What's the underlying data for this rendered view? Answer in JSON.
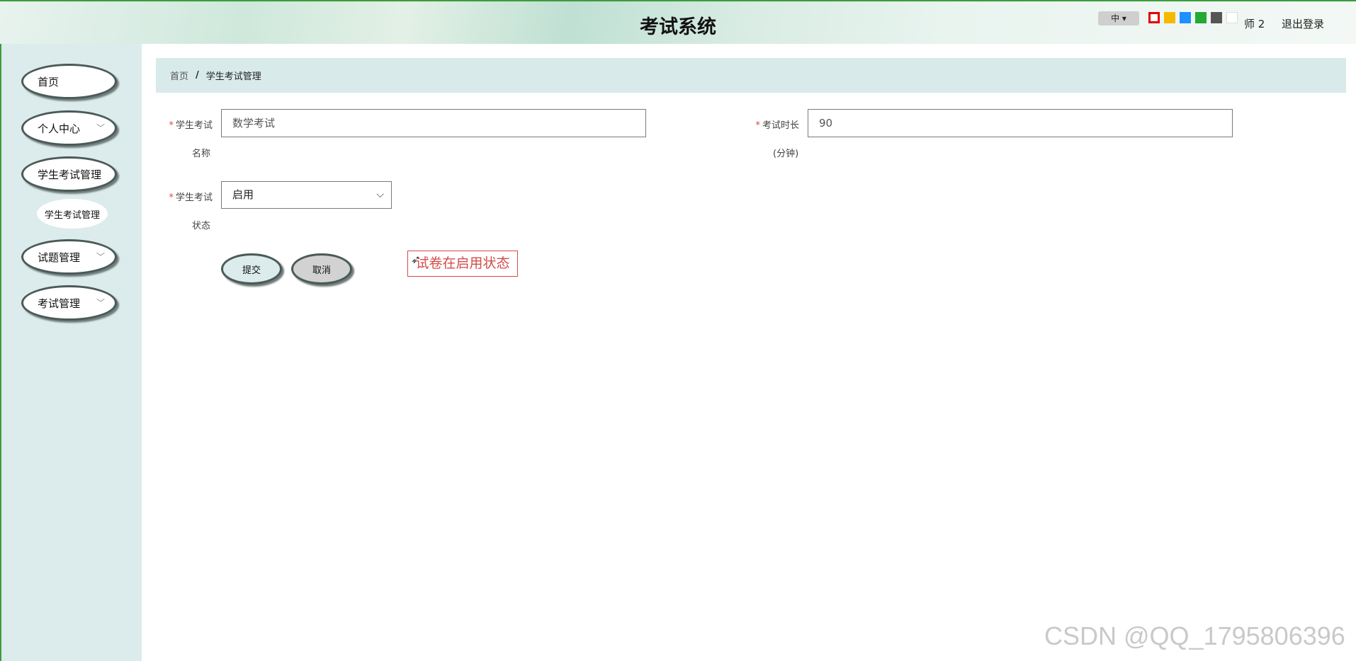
{
  "header": {
    "title": "考试系统",
    "language": "中",
    "theme_colors": [
      "#ffffff",
      "#f7b900",
      "#1e90ff",
      "#22aa33",
      "#555555",
      "#ffffff"
    ],
    "theme_selected_border": "#e00000",
    "user_name": "师 2",
    "logout_label": "退出登录"
  },
  "sidebar": {
    "items": [
      {
        "label": "首页"
      },
      {
        "label": "个人中心"
      },
      {
        "label": "学生考试管理"
      },
      {
        "label": "试题管理"
      },
      {
        "label": "考试管理"
      }
    ],
    "sub_item": "学生考试管理"
  },
  "breadcrumb": {
    "home": "首页",
    "separator": "/",
    "current": "学生考试管理"
  },
  "form": {
    "exam_name": {
      "label_line1": "学生考试",
      "label_line2": "名称",
      "value": "数学考试"
    },
    "duration": {
      "label_line1": "考试时长",
      "label_line2": "(分钟)",
      "value": "90"
    },
    "status": {
      "label_line1": "学生考试",
      "label_line2": "状态",
      "value": "启用"
    },
    "required_mark": "*",
    "submit_label": "提交",
    "cancel_label": "取消",
    "hint": "试卷在启用状态"
  },
  "watermark": "CSDN @QQ_1795806396"
}
